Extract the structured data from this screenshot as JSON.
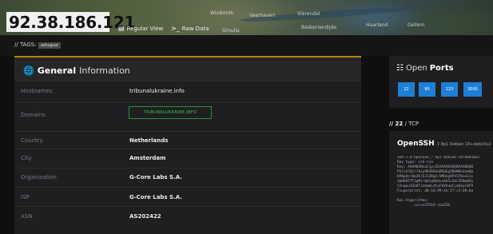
{
  "header": {
    "ip": "92.38.186.121",
    "regular_view_label": "Regular View",
    "raw_data_label": "Raw Data",
    "map_labels": [
      "Wisdomik",
      "Veerhaveri",
      "Ornulia",
      "Vierendel",
      "Baskerlandijde",
      "Haarland",
      "Gellern"
    ]
  },
  "tags": {
    "label": "// TAGS:",
    "items": [
      "self-signed"
    ]
  },
  "general": {
    "title_bold": "General",
    "title_light": "Information",
    "rows": [
      {
        "label": "Hostnames",
        "value": "tribunalukraine.info"
      },
      {
        "label": "Domains",
        "value": "TRIBUNALUKRAINE.INFO"
      },
      {
        "label": "Country",
        "value": "Netherlands"
      },
      {
        "label": "City",
        "value": "Amsterdam"
      },
      {
        "label": "Organization",
        "value": "G-Core Labs S.A."
      },
      {
        "label": "ISP",
        "value": "G-Core Labs S.A."
      },
      {
        "label": "ASN",
        "value": "AS202422"
      }
    ]
  },
  "ports": {
    "title_light": "Open",
    "title_bold": "Ports",
    "list": [
      "22",
      "80",
      "123",
      "3000"
    ]
  },
  "service": {
    "port_label": "// 22",
    "proto_label": "/ TCP",
    "name": "OpenSSH",
    "version": "7.9p1 Debian 10+deb10u2",
    "banner": "SSH-2.0-OpenSSH_7.9p1 Debian-10+deb10u2\nKey type: ssh-rsa\nKey: AAAAB3NzaC1yc2EAAAADAQABAAABAQD\nPhlsX7Q1/74xy9K3R03eDRaEg5N4WHeQzm8p\nKP8p0z+Wa2K/EJ13RgF/VMDeg8FV1TKoeS1s\n1mHK8T7T2gMi+Qb2g9b4xn4b5z3kC5R0w8Vy\nt2nqwuISHdTJokmkLdtyFkVAumCjmdkpl8F9\nFingerprint: d8:18:99:4e:17:c5:89:6a\n\nKex Algorithms:\n\tcurve25519-sha256"
  }
}
